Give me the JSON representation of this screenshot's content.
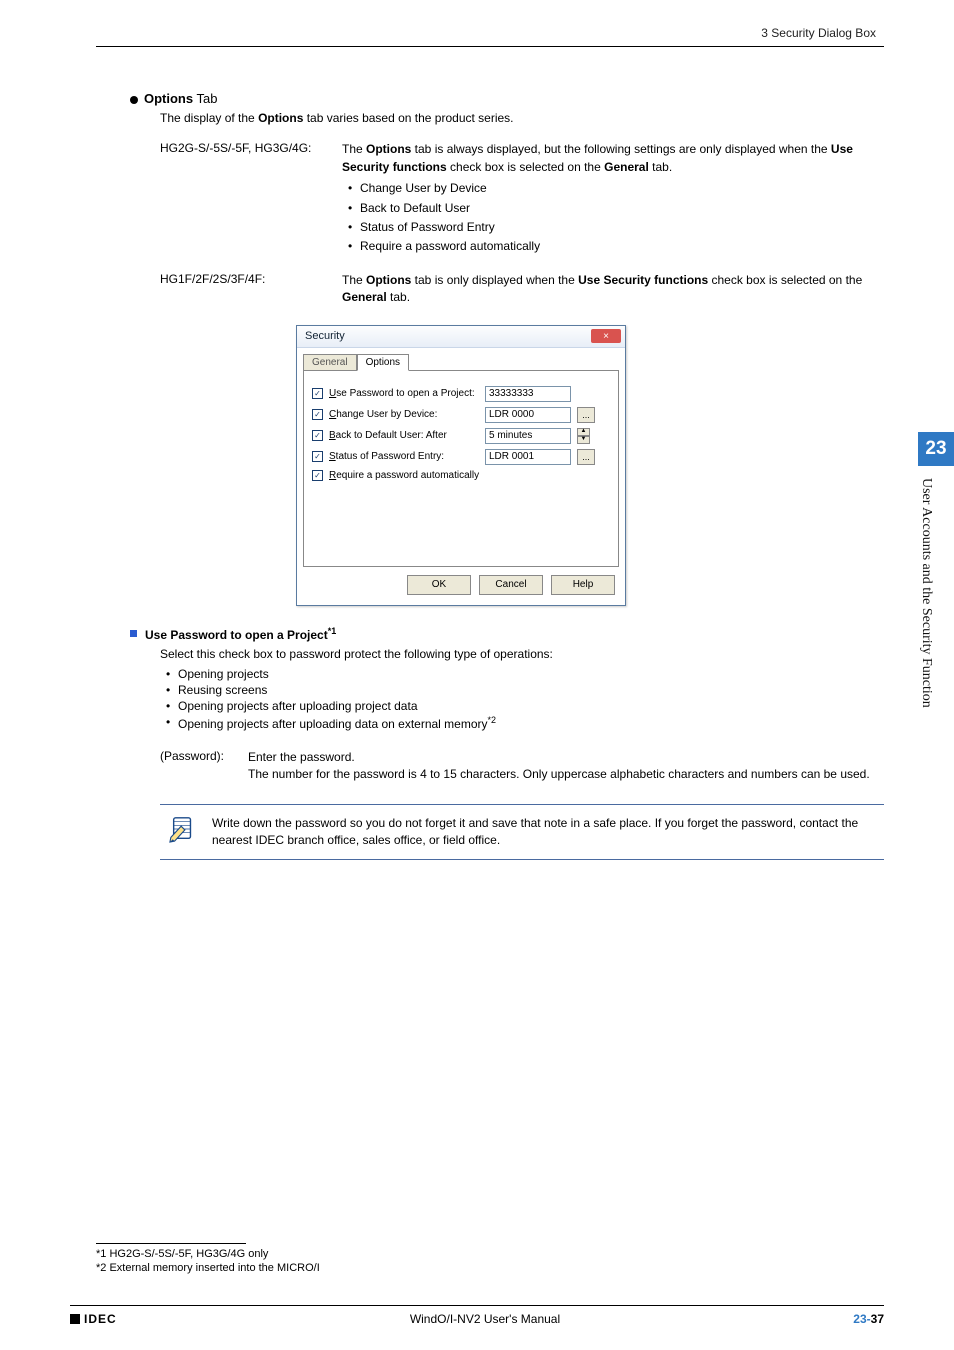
{
  "header": {
    "breadcrumb": "3 Security Dialog Box"
  },
  "section": {
    "heading_strong": "Options",
    "heading_rest": " Tab",
    "intro_pre": "The display of the ",
    "intro_bold": "Options",
    "intro_post": " tab varies based on the product series."
  },
  "rows": [
    {
      "label": "HG2G-S/-5S/-5F, HG3G/4G:",
      "p1_pre": "The ",
      "p1_b1": "Options",
      "p1_mid": " tab is always displayed, but the following settings are only displayed when the ",
      "p1_b2": "Use Security functions",
      "p1_mid2": " check box is selected on the ",
      "p1_b3": "General",
      "p1_post": " tab.",
      "bullets": [
        "Change User by Device",
        "Back to Default User",
        "Status of Password Entry",
        "Require a password automatically"
      ]
    },
    {
      "label": "HG1F/2F/2S/3F/4F:",
      "p1_pre": "The ",
      "p1_b1": "Options",
      "p1_mid": " tab is only displayed when the ",
      "p1_b2": "Use Security functions",
      "p1_mid2": " check box is selected on the ",
      "p1_b3": "General",
      "p1_post": " tab."
    }
  ],
  "dialog": {
    "title": "Security",
    "close": "×",
    "tabs": {
      "general": "General",
      "options": "Options"
    },
    "fields": {
      "use_pw_label": "Use Password to open a Project:",
      "use_pw_value": "33333333",
      "change_user_label": "Change User by Device:",
      "change_user_value": "LDR 0000",
      "back_default_label": "Back to Default User:  After",
      "back_default_value": "5 minutes",
      "status_pw_label": "Status of Password Entry:",
      "status_pw_value": "LDR 0001",
      "require_pw_label": "Require a password automatically"
    },
    "buttons": {
      "ok": "OK",
      "cancel": "Cancel",
      "help": "Help"
    }
  },
  "sub": {
    "heading": "Use Password to open a Project",
    "sup": "*1",
    "intro": "Select this check box to password protect the following type of operations:",
    "bullets": [
      "Opening projects",
      "Reusing screens",
      "Opening projects after uploading project data"
    ],
    "bullet_last_pre": "Opening projects after uploading data on external memory",
    "bullet_last_sup": "*2"
  },
  "password": {
    "key": "(Password):",
    "line1": "Enter the password.",
    "line2": "The number for the password is 4 to 15 characters. Only uppercase alphabetic characters and numbers can be used."
  },
  "note": {
    "text": "Write down the password so you do not forget it and save that note in a safe place. If you forget the password, contact the nearest IDEC branch office, sales office, or field office."
  },
  "sidetab": {
    "num": "23",
    "label": "User Accounts and the Security Function"
  },
  "footnotes": {
    "f1": "*1  HG2G-S/-5S/-5F, HG3G/4G only",
    "f2": "*2  External memory inserted into the MICRO/I"
  },
  "footer": {
    "logo": "IDEC",
    "center": "WindO/I-NV2 User's Manual",
    "pg_chapter": "23-",
    "pg_num": "37"
  }
}
